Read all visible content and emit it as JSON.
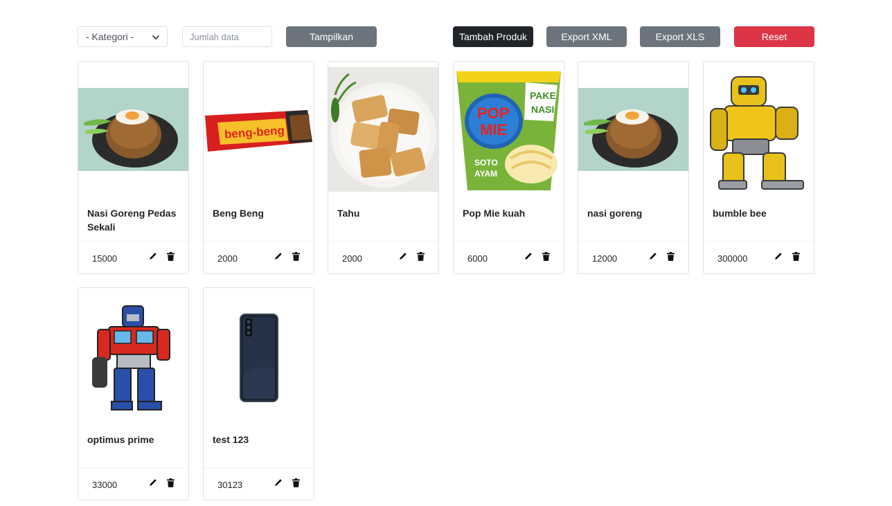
{
  "toolbar": {
    "category_select": "- Kategori -",
    "count_placeholder": "Jumlah data",
    "show_button": "Tampilkan",
    "add_button": "Tambah Produk",
    "export_xml_button": "Export XML",
    "export_xls_button": "Export XLS",
    "reset_button": "Reset"
  },
  "colors": {
    "primary_dark": "#212529",
    "secondary": "#6c757d",
    "danger": "#dc3545"
  },
  "products": [
    {
      "name": "Nasi Goreng Pedas Sekali",
      "price": "15000",
      "image": "fried-rice-image"
    },
    {
      "name": "Beng Beng",
      "price": "2000",
      "image": "chocolate-bar-image"
    },
    {
      "name": "Tahu",
      "price": "2000",
      "image": "fried-tofu-image"
    },
    {
      "name": "Pop Mie kuah",
      "price": "6000",
      "image": "instant-noodle-cup-image"
    },
    {
      "name": "nasi goreng",
      "price": "12000",
      "image": "fried-rice-image"
    },
    {
      "name": "bumble bee",
      "price": "300000",
      "image": "yellow-robot-image"
    },
    {
      "name": "optimus prime",
      "price": "33000",
      "image": "red-blue-robot-image"
    },
    {
      "name": "test 123",
      "price": "30123",
      "image": "smartphone-image"
    }
  ],
  "icons": {
    "edit": "pencil-icon",
    "delete": "trash-icon",
    "dropdown": "chevron-down-icon"
  }
}
